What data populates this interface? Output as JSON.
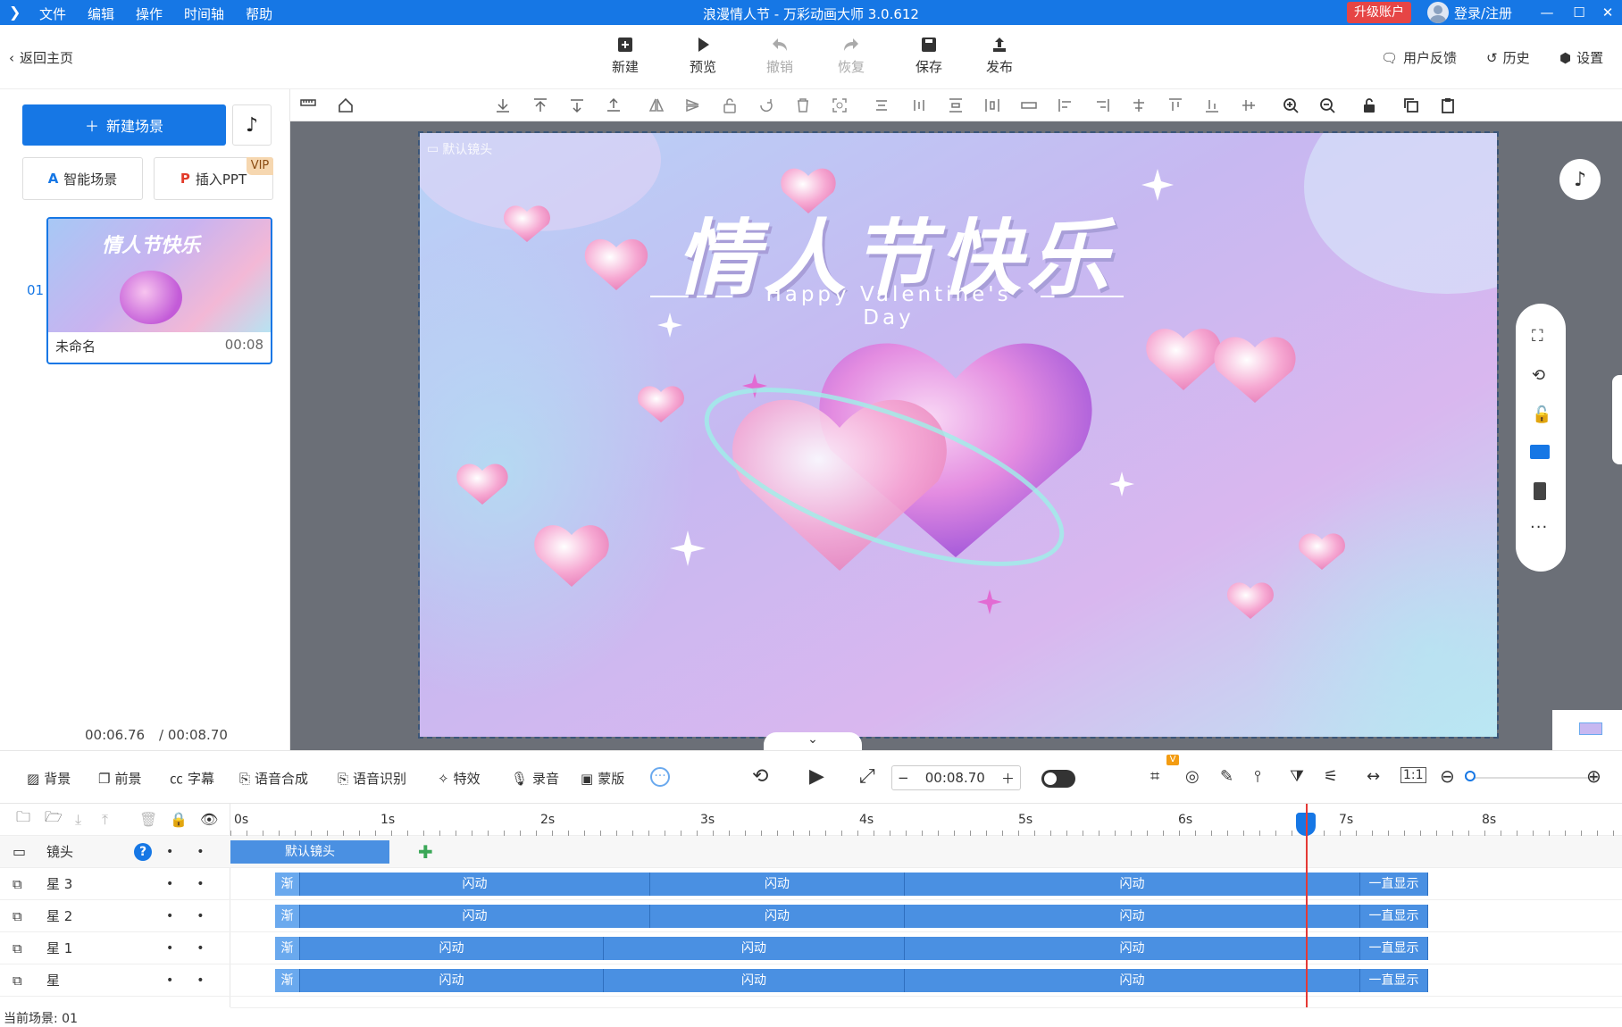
{
  "window": {
    "title": "浪漫情人节 - 万彩动画大师 3.0.612",
    "menu": [
      "文件",
      "编辑",
      "操作",
      "时间轴",
      "帮助"
    ],
    "upgrade": "升级账户",
    "login": "登录/注册"
  },
  "toolbar": {
    "back": "返回主页",
    "tools": [
      {
        "label": "新建",
        "icon": "plus-square-icon",
        "enabled": true
      },
      {
        "label": "预览",
        "icon": "play-icon",
        "enabled": true
      },
      {
        "label": "撤销",
        "icon": "undo-icon",
        "enabled": false
      },
      {
        "label": "恢复",
        "icon": "redo-icon",
        "enabled": false
      },
      {
        "label": "保存",
        "icon": "save-icon",
        "enabled": true
      },
      {
        "label": "发布",
        "icon": "publish-icon",
        "enabled": true
      }
    ],
    "feedback": "用户反馈",
    "history": "历史",
    "settings": "设置"
  },
  "left": {
    "new_scene": "新建场景",
    "smart_scene": "智能场景",
    "insert_ppt": "插入PPT",
    "vip": "VIP",
    "scene_number": "01",
    "scene_name": "未命名",
    "scene_duration": "00:08",
    "thumb_title": "情人节快乐",
    "current_time": "00:06.76",
    "total_time": "/ 00:08.70"
  },
  "canvas": {
    "camera_label": "默认镜头",
    "title": "情人节快乐",
    "subtitle": "Happy Valentine's Day"
  },
  "timeline_toolbar": {
    "items": [
      "背景",
      "前景",
      "字幕",
      "语音合成",
      "语音识别",
      "特效",
      "录音",
      "蒙版"
    ],
    "time": "00:08.70"
  },
  "timeline": {
    "ruler": [
      "0s",
      "1s",
      "2s",
      "3s",
      "4s",
      "5s",
      "6s",
      "7s",
      "8s"
    ],
    "camera_row": {
      "name": "镜头",
      "clip": "默认镜头"
    },
    "layers": [
      {
        "name": "星 3",
        "clips": [
          {
            "label": "渐变",
            "w": 28
          },
          {
            "label": "闪动",
            "w": 392
          },
          {
            "label": "闪动",
            "w": 285
          },
          {
            "label": "闪动",
            "w": 510
          },
          {
            "label": "一直显示",
            "w": 76
          }
        ]
      },
      {
        "name": "星 2",
        "clips": [
          {
            "label": "渐变",
            "w": 28
          },
          {
            "label": "闪动",
            "w": 392
          },
          {
            "label": "闪动",
            "w": 285
          },
          {
            "label": "闪动",
            "w": 510
          },
          {
            "label": "一直显示",
            "w": 76
          }
        ]
      },
      {
        "name": "星 1",
        "clips": [
          {
            "label": "渐变",
            "w": 28
          },
          {
            "label": "闪动",
            "w": 340
          },
          {
            "label": "闪动",
            "w": 337
          },
          {
            "label": "闪动",
            "w": 510
          },
          {
            "label": "一直显示",
            "w": 76
          }
        ]
      },
      {
        "name": "星",
        "clips": [
          {
            "label": "渐变",
            "w": 28
          },
          {
            "label": "闪动",
            "w": 340
          },
          {
            "label": "闪动",
            "w": 337
          },
          {
            "label": "闪动",
            "w": 510
          },
          {
            "label": "一直显示",
            "w": 76
          }
        ]
      }
    ],
    "status": "当前场景: 01"
  }
}
